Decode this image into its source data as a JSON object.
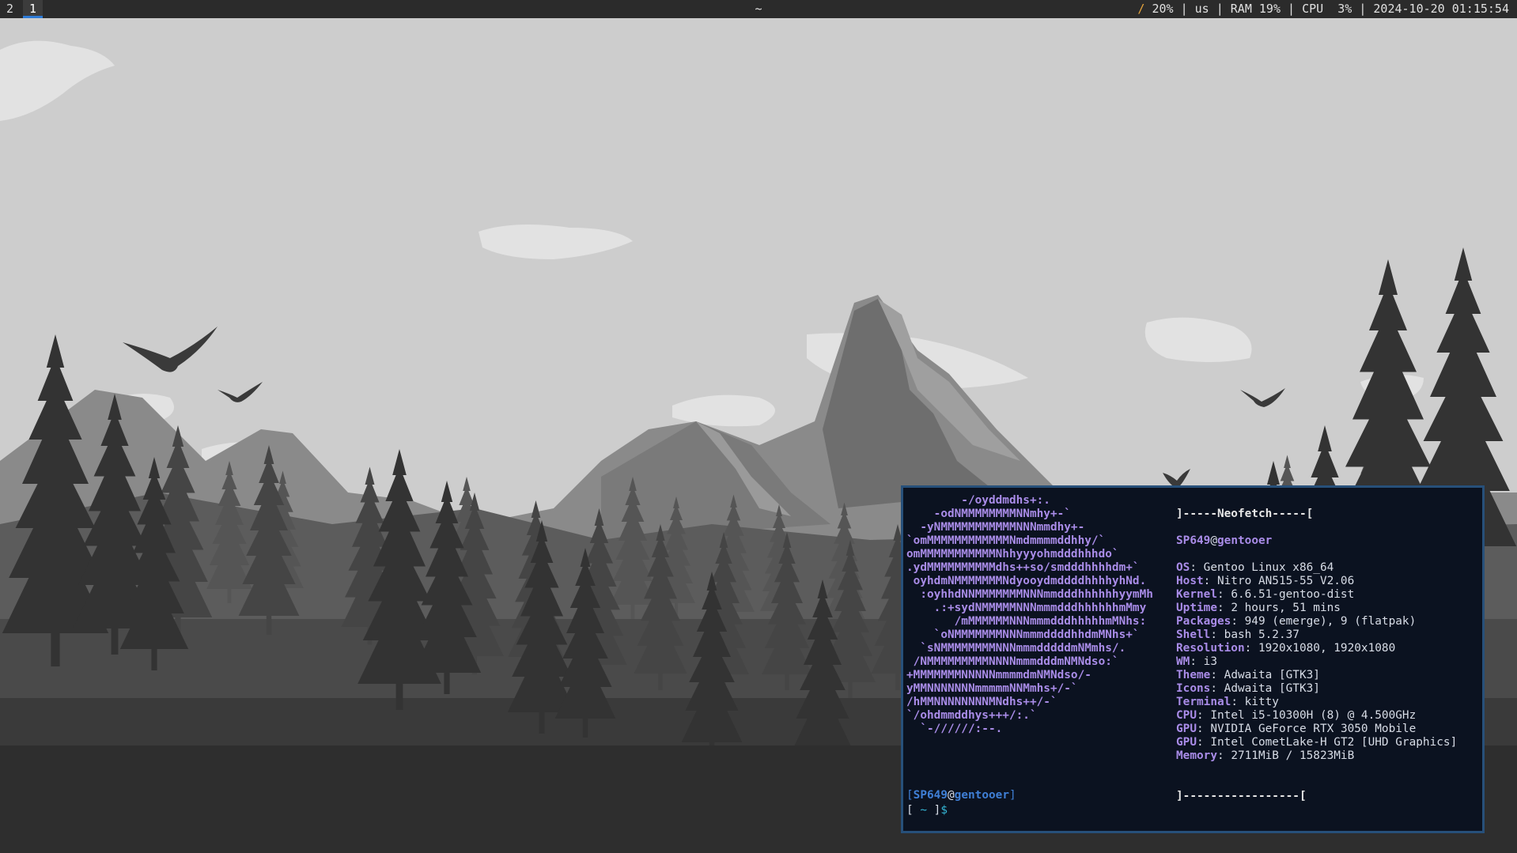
{
  "topbar": {
    "workspaces": [
      "2",
      "1"
    ],
    "active_workspace": "1",
    "window_title": "~",
    "status": {
      "disk_icon": "/",
      "disk": "20%",
      "sep": "|",
      "layout": "us",
      "ram": "RAM 19%",
      "cpu": "CPU  3%",
      "datetime": "2024-10-20 01:15:54"
    }
  },
  "terminal": {
    "logo_lines": [
      "        -/oyddmdhs+:.",
      "    -odNMMMMMMMMNNmhy+-`",
      "  -yNMMMMMMMMMMMNNNmmdhy+-",
      "`omMMMMMMMMMMMMNmdmmmmddhhy/`",
      "omMMMMMMMMMMMNhhyyyohmdddhhhdo`",
      ".ydMMMMMMMMMMdhs++so/smdddhhhhdm+`",
      " oyhdmNMMMMMMMNdyooydmddddhhhhyhNd.",
      "  :oyhhdNNMMMMMMMNNNmmdddhhhhhhyymMh",
      "    .:+sydNMMMMMNNNmmmdddhhhhhhmMmy",
      "       /mMMMMMMNNNmmmdddhhhhhmMNhs:",
      "    `oNMMMMMMMNNNmmmddddhhdmMNhs+`",
      "  `sNMMMMMMMMNNNmmmdddddmNMmhs/.",
      " /NMMMMMMMMMNNNNmmmdddmNMNdso:`",
      "+MMMMMMMNNNNNmmmmdmNMNdso/-",
      "yMMNNNNNNNmmmmmNNMmhs+/-`",
      "/hMMNNNNNNNNMNdhs++/-`",
      "`/ohdmmddhys+++/:.`",
      "  `-//////:--."
    ],
    "info": {
      "header": "]-----Neofetch-----[",
      "user": "SP649",
      "at": "@",
      "host": "gentooer",
      "rows": [
        {
          "key": "OS",
          "value": "Gentoo Linux x86_64"
        },
        {
          "key": "Host",
          "value": "Nitro AN515-55 V2.06"
        },
        {
          "key": "Kernel",
          "value": "6.6.51-gentoo-dist"
        },
        {
          "key": "Uptime",
          "value": "2 hours, 51 mins"
        },
        {
          "key": "Packages",
          "value": "949 (emerge), 9 (flatpak)"
        },
        {
          "key": "Shell",
          "value": "bash 5.2.37"
        },
        {
          "key": "Resolution",
          "value": "1920x1080, 1920x1080"
        },
        {
          "key": "WM",
          "value": "i3"
        },
        {
          "key": "Theme",
          "value": "Adwaita [GTK3]"
        },
        {
          "key": "Icons",
          "value": "Adwaita [GTK3]"
        },
        {
          "key": "Terminal",
          "value": "kitty"
        },
        {
          "key": "CPU",
          "value": "Intel i5-10300H (8) @ 4.500GHz"
        },
        {
          "key": "GPU",
          "value": "NVIDIA GeForce RTX 3050 Mobile"
        },
        {
          "key": "GPU",
          "value": "Intel CometLake-H GT2 [UHD Graphics]"
        },
        {
          "key": "Memory",
          "value": "2711MiB / 15823MiB"
        }
      ],
      "footer": "]-----------------["
    },
    "prompt": {
      "open_bracket": "[",
      "user": "SP649",
      "at": "@",
      "host": "gentooer",
      "close_bracket": "]",
      "line2_open": "[ ",
      "cwd": "~",
      "line2_close": " ]",
      "symbol": "$"
    }
  },
  "wallpaper": {
    "description_icon": "mountain-forest-wallpaper"
  }
}
